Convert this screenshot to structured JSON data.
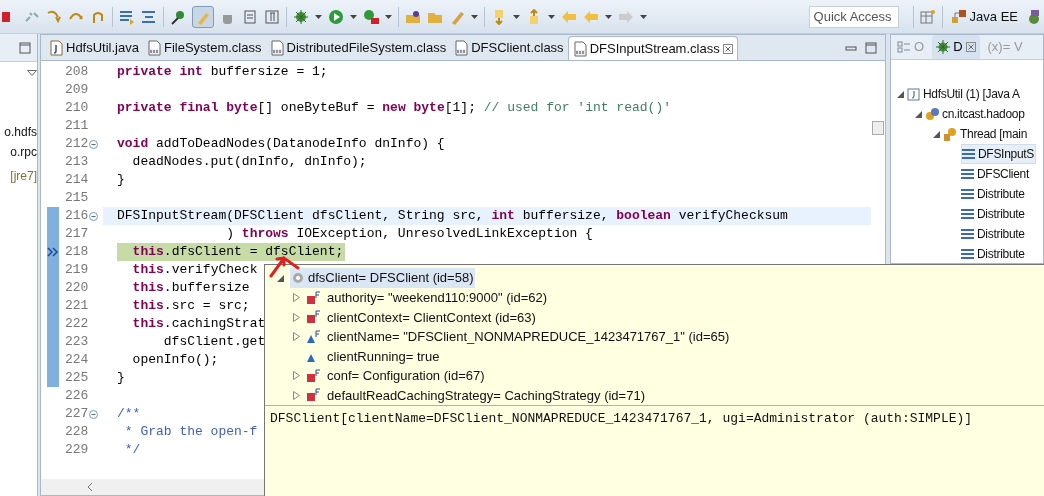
{
  "toolbar": {
    "quick_access": {
      "placeholder": "Quick Access"
    },
    "perspective": {
      "label": "Java EE"
    }
  },
  "left_panel": {
    "items": [
      "o.hdfs",
      "o.rpc",
      "[jre7]"
    ]
  },
  "editor": {
    "tabs": [
      {
        "label": "HdfsUtil.java",
        "kind": "java",
        "selected": false
      },
      {
        "label": "FileSystem.class",
        "kind": "class",
        "selected": false
      },
      {
        "label": "DistributedFileSystem.class",
        "kind": "class",
        "selected": false
      },
      {
        "label": "DFSClient.class",
        "kind": "class",
        "selected": false
      },
      {
        "label": "DFSInputStream.class",
        "kind": "class",
        "selected": true
      }
    ],
    "lines": [
      {
        "number": "208",
        "fold_marker": false,
        "current_line": false,
        "debug_line": false,
        "in_range": false,
        "segments": [
          {
            "kind": "code",
            "text": "**private** **int** buffersize = 1;"
          }
        ]
      },
      {
        "number": "209",
        "fold_marker": false,
        "current_line": false,
        "debug_line": false,
        "in_range": false
      },
      {
        "number": "210",
        "fold_marker": false,
        "current_line": false,
        "debug_line": false,
        "in_range": false,
        "segments": [
          {
            "kind": "code",
            "text": "**private** **final** **byte**[] oneByteBuf = **new** **byte**[1];"
          },
          {
            "kind": "comment",
            "text": "// used for 'int read()'"
          }
        ]
      },
      {
        "number": "211",
        "fold_marker": false,
        "current_line": false,
        "debug_line": false,
        "in_range": false
      },
      {
        "number": "212",
        "fold_marker": true,
        "current_line": false,
        "debug_line": false,
        "in_range": false,
        "segments": [
          {
            "kind": "code",
            "text": "**void** addToDeadNodes(DatanodeInfo dnInfo) {"
          }
        ]
      },
      {
        "number": "213",
        "fold_marker": false,
        "current_line": false,
        "debug_line": false,
        "in_range": false,
        "segments": [
          {
            "kind": "code",
            "text": "  deadNodes.put(dnInfo, dnInfo);"
          }
        ]
      },
      {
        "number": "214",
        "fold_marker": false,
        "current_line": false,
        "debug_line": false,
        "in_range": false,
        "segments": [
          {
            "kind": "code",
            "text": "}"
          }
        ]
      },
      {
        "number": "215",
        "fold_marker": false,
        "current_line": false,
        "debug_line": false,
        "in_range": false
      },
      {
        "number": "216",
        "fold_marker": true,
        "current_line": true,
        "debug_line": false,
        "in_range": true,
        "segments": [
          {
            "kind": "code",
            "text": "DFSInputStream(DFSClient dfsClient, String src, **int** buffersize, **boolean** verifyChecksum"
          }
        ]
      },
      {
        "number": "217",
        "fold_marker": false,
        "current_line": false,
        "debug_line": false,
        "in_range": true,
        "segments": [
          {
            "kind": "code",
            "text": "              ) **throws** IOException, UnresolvedLinkException {"
          }
        ]
      },
      {
        "number": "218",
        "fold_marker": false,
        "current_line": false,
        "debug_line": true,
        "in_range": true,
        "segments": [
          {
            "kind": "code",
            "text": "  **this**.dfsClient = dfsClient;"
          }
        ]
      },
      {
        "number": "219",
        "fold_marker": false,
        "current_line": false,
        "debug_line": false,
        "in_range": true,
        "segments": [
          {
            "kind": "code",
            "text": "  **this**.verifyCheck"
          }
        ]
      },
      {
        "number": "220",
        "fold_marker": false,
        "current_line": false,
        "debug_line": false,
        "in_range": true,
        "segments": [
          {
            "kind": "code",
            "text": "  **this**.buffersize"
          }
        ]
      },
      {
        "number": "221",
        "fold_marker": false,
        "current_line": false,
        "debug_line": false,
        "in_range": true,
        "segments": [
          {
            "kind": "code",
            "text": "  **this**.src = src;"
          }
        ]
      },
      {
        "number": "222",
        "fold_marker": false,
        "current_line": false,
        "debug_line": false,
        "in_range": true,
        "segments": [
          {
            "kind": "code",
            "text": "  **this**.cachingStrat"
          }
        ]
      },
      {
        "number": "223",
        "fold_marker": false,
        "current_line": false,
        "debug_line": false,
        "in_range": true,
        "segments": [
          {
            "kind": "code",
            "text": "      dfsClient.get"
          }
        ]
      },
      {
        "number": "224",
        "fold_marker": false,
        "current_line": false,
        "debug_line": false,
        "in_range": true,
        "segments": [
          {
            "kind": "code",
            "text": "  openInfo();"
          }
        ]
      },
      {
        "number": "225",
        "fold_marker": false,
        "current_line": false,
        "debug_line": false,
        "in_range": true,
        "segments": [
          {
            "kind": "code",
            "text": "}"
          }
        ]
      },
      {
        "number": "226",
        "fold_marker": false,
        "current_line": false,
        "debug_line": false,
        "in_range": false
      },
      {
        "number": "227",
        "fold_marker": true,
        "current_line": false,
        "debug_line": false,
        "in_range": false,
        "segments": [
          {
            "kind": "javadoc",
            "text": "/**"
          }
        ]
      },
      {
        "number": "228",
        "fold_marker": false,
        "current_line": false,
        "debug_line": false,
        "in_range": false,
        "segments": [
          {
            "kind": "javadoc",
            "text": " * Grab the open-f"
          }
        ]
      },
      {
        "number": "229",
        "fold_marker": false,
        "current_line": false,
        "debug_line": false,
        "in_range": false,
        "segments": [
          {
            "kind": "javadoc",
            "text": " */"
          }
        ]
      }
    ]
  },
  "debug_panel": {
    "tabs": [
      {
        "label": "O",
        "kind": "outline",
        "selected": false
      },
      {
        "label": "D",
        "kind": "debug",
        "selected": true
      },
      {
        "label": "(x)= V",
        "kind": "variables",
        "selected": false
      }
    ],
    "tree": [
      {
        "label": "HdfsUtil (1) [Java A",
        "kind": "launch",
        "expanded": true,
        "selected": false,
        "children": [
          {
            "label": "cn.itcast.hadoop",
            "kind": "vm",
            "expanded": true,
            "selected": false,
            "children": [
              {
                "label": "Thread [main",
                "kind": "thread",
                "expanded": true,
                "selected": false,
                "children": [
                  {
                    "label": "DFSInputS",
                    "kind": "frame",
                    "selected": true
                  },
                  {
                    "label": "DFSClient",
                    "kind": "frame",
                    "selected": false
                  },
                  {
                    "label": "Distribute",
                    "kind": "frame",
                    "selected": false
                  },
                  {
                    "label": "Distribute",
                    "kind": "frame",
                    "selected": false
                  },
                  {
                    "label": "Distribute",
                    "kind": "frame",
                    "selected": false
                  },
                  {
                    "label": "Distribute",
                    "kind": "frame",
                    "selected": false
                  }
                ]
              }
            ]
          }
        ]
      }
    ]
  },
  "inspect_popup": {
    "variable": {
      "label": "dfsClient= DFSClient  (id=58)",
      "kind": "local",
      "expanded": true,
      "selected": true,
      "children": [
        {
          "label": "authority= \"weekend110:9000\" (id=62)",
          "kind": "private",
          "expandable": true
        },
        {
          "label": "clientContext= ClientContext  (id=63)",
          "kind": "private",
          "expandable": true
        },
        {
          "label": "clientName= \"DFSClient_NONMAPREDUCE_1423471767_1\" (id=65)",
          "kind": "final",
          "expandable": true
        },
        {
          "label": "clientRunning= true",
          "kind": "package",
          "expandable": false
        },
        {
          "label": "conf= Configuration  (id=67)",
          "kind": "private",
          "expandable": true
        },
        {
          "label": "defaultReadCachingStrategy= CachingStrategy  (id=71)",
          "kind": "private",
          "expandable": true
        }
      ]
    },
    "detail": "DFSClient[clientName=DFSClient_NONMAPREDUCE_1423471767_1, ugi=Administrator (auth:SIMPLE)]"
  }
}
